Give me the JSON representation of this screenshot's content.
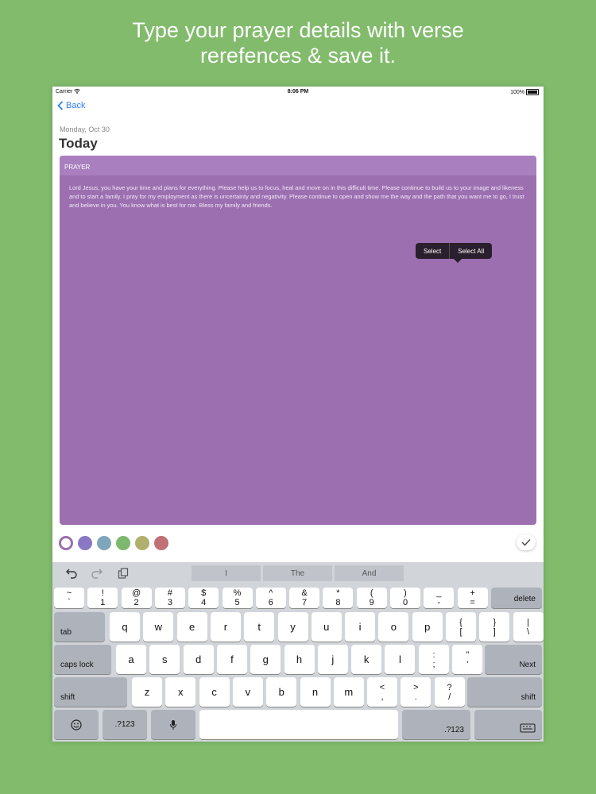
{
  "caption": {
    "line1": "Type your prayer details with verse",
    "line2": "rerefences & save it."
  },
  "status_bar": {
    "carrier": "Carrier",
    "time": "8:06 PM",
    "battery": "100%"
  },
  "nav": {
    "back_label": "Back"
  },
  "entry": {
    "date": "Monday, Oct 30",
    "title": "Today"
  },
  "prayer": {
    "header": "PRAYER",
    "text": "Lord Jesus, you have your time and plans for everything. Please help us to focus, heal and move on in this difficult time. Please continue to build us to your image and likeness and to start a family. I pray for my employment as there is uncertainty and negativity. Please continue to open and show me the way and the path that you want me to go, I trust and believe in you. You know what is best for me. Bless my family and friends.",
    "background": "#9b6fb0"
  },
  "popover": {
    "select": "Select",
    "select_all": "Select All"
  },
  "color_swatches": [
    "#ffffff",
    "#8a78c4",
    "#7fa6ba",
    "#7eb86e",
    "#b2ae6e",
    "#c07175"
  ],
  "selected_swatch": 0,
  "done_icon": "checkmark-icon",
  "keyboard": {
    "tools": [
      "undo-icon",
      "redo-icon",
      "paste-icon"
    ],
    "suggestions": [
      "I",
      "The",
      "And"
    ],
    "row_numbers": [
      {
        "top": "~",
        "bot": "`"
      },
      {
        "top": "!",
        "bot": "1"
      },
      {
        "top": "@",
        "bot": "2"
      },
      {
        "top": "#",
        "bot": "3"
      },
      {
        "top": "$",
        "bot": "4"
      },
      {
        "top": "%",
        "bot": "5"
      },
      {
        "top": "^",
        "bot": "6"
      },
      {
        "top": "&",
        "bot": "7"
      },
      {
        "top": "*",
        "bot": "8"
      },
      {
        "top": "(",
        "bot": "9"
      },
      {
        "top": ")",
        "bot": "0"
      },
      {
        "top": "_",
        "bot": "-"
      },
      {
        "top": "+",
        "bot": "="
      }
    ],
    "delete": "delete",
    "tab": "tab",
    "row_q": [
      "q",
      "w",
      "e",
      "r",
      "t",
      "y",
      "u",
      "i",
      "o",
      "p"
    ],
    "row_q_extra": [
      {
        "top": "{",
        "bot": "["
      },
      {
        "top": "}",
        "bot": "]"
      },
      {
        "top": "|",
        "bot": "\\"
      }
    ],
    "caps_lock": "caps lock",
    "row_a": [
      "a",
      "s",
      "d",
      "f",
      "g",
      "h",
      "j",
      "k",
      "l"
    ],
    "row_a_extra": [
      {
        "top": ":",
        "bot": ";"
      },
      {
        "top": "\"",
        "bot": "'"
      }
    ],
    "next": "Next",
    "shift": "shift",
    "row_z": [
      "z",
      "x",
      "c",
      "v",
      "b",
      "n",
      "m"
    ],
    "row_z_extra": [
      {
        "top": "<",
        "bot": ","
      },
      {
        "top": ">",
        "bot": "."
      },
      {
        "top": "?",
        "bot": "/"
      }
    ],
    "shift_right": "shift",
    "emoji_icon": "emoji-icon",
    "numbers_left": ".?123",
    "mic_icon": "microphone-icon",
    "numbers_right": ".?123",
    "dismiss_icon": "keyboard-dismiss-icon"
  }
}
